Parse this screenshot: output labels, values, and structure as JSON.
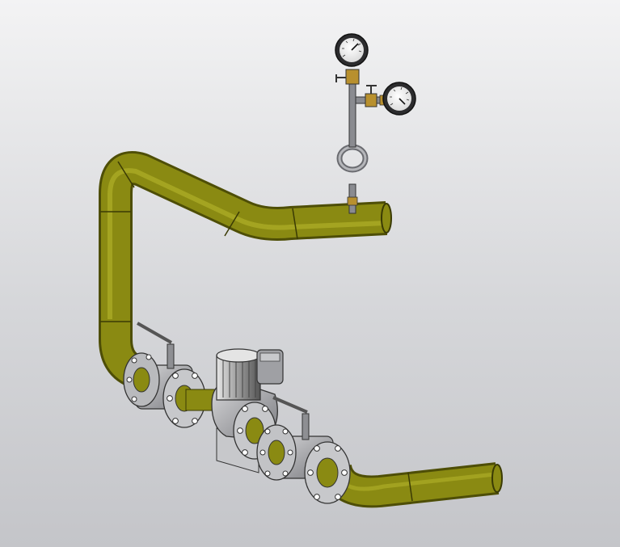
{
  "scene": {
    "pipe_color": "#8a8a12",
    "pipe_highlight": "#b9b92e",
    "pipe_shadow": "#4e4e06",
    "metal_color": "#a9aaae",
    "metal_dark": "#6a6b70",
    "brass_color": "#b8902e",
    "background_top": "#f3f3f4",
    "background_bottom": "#c4c5c9"
  },
  "components": [
    {
      "name": "main-pipeline"
    },
    {
      "name": "ball-valve-left"
    },
    {
      "name": "ball-valve-right"
    },
    {
      "name": "circulation-pump"
    },
    {
      "name": "pressure-gauge-upper"
    },
    {
      "name": "pressure-gauge-lower"
    },
    {
      "name": "siphon-loop"
    }
  ]
}
